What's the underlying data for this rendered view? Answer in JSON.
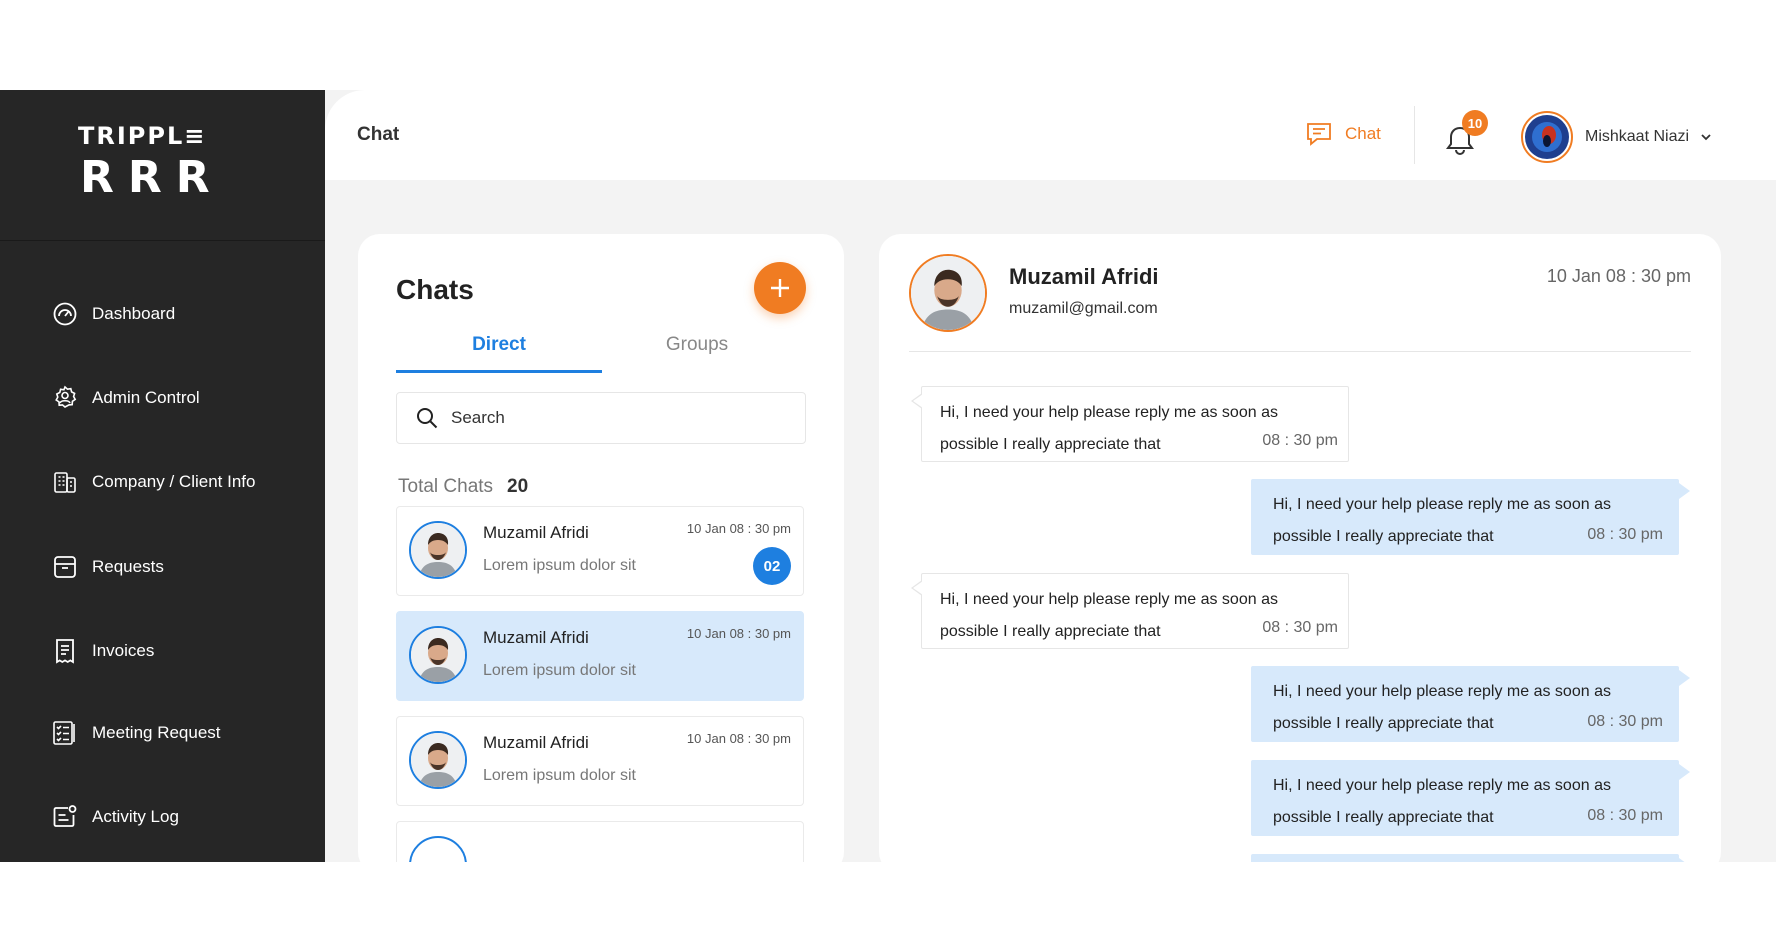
{
  "brand": {
    "line1": "TRIPPL≡",
    "line2": "RRR"
  },
  "sidebar": {
    "items": [
      {
        "label": "Dashboard",
        "icon": "dashboard-gauge-icon"
      },
      {
        "label": "Admin Control",
        "icon": "admin-gear-person-icon"
      },
      {
        "label": "Company / Client Info",
        "icon": "building-icon"
      },
      {
        "label": "Requests",
        "icon": "archive-box-icon"
      },
      {
        "label": "Invoices",
        "icon": "receipt-icon"
      },
      {
        "label": "Meeting Request",
        "icon": "checklist-icon"
      },
      {
        "label": "Activity Log",
        "icon": "activity-log-icon"
      }
    ]
  },
  "header": {
    "title": "Chat",
    "chat_link": "Chat",
    "notification_count": "10",
    "user_name": "Mishkaat Niazi"
  },
  "chats": {
    "title": "Chats",
    "tabs": [
      "Direct",
      "Groups"
    ],
    "active_tab": "Direct",
    "search_placeholder": "Search",
    "total_label": "Total Chats",
    "total_count": "20",
    "items": [
      {
        "name": "Muzamil Afridi",
        "message": "Lorem ipsum dolor sit",
        "time": "10 Jan 08 : 30 pm",
        "unread": "02",
        "active": false
      },
      {
        "name": "Muzamil Afridi",
        "message": "Lorem ipsum dolor sit",
        "time": "10 Jan 08 : 30 pm",
        "unread": "",
        "active": true
      },
      {
        "name": "Muzamil Afridi",
        "message": "Lorem ipsum dolor sit",
        "time": "10 Jan 08 : 30 pm",
        "unread": "",
        "active": false
      }
    ]
  },
  "conversation": {
    "name": "Muzamil Afridi",
    "email": "muzamil@gmail.com",
    "time": "10 Jan 08 : 30 pm",
    "messages": [
      {
        "direction": "in",
        "line1": "Hi, I need your help please reply me as soon as",
        "line2": "possible I really appreciate that",
        "time": "08 : 30 pm"
      },
      {
        "direction": "out",
        "line1": "Hi, I need your help please reply me as soon as",
        "line2": "possible I really appreciate that",
        "time": "08 : 30 pm"
      },
      {
        "direction": "in",
        "line1": "Hi, I need your help please reply me as soon as",
        "line2": "possible I really appreciate that",
        "time": "08 : 30 pm"
      },
      {
        "direction": "out",
        "line1": "Hi, I need your help please reply me as soon as",
        "line2": "possible I really appreciate that",
        "time": "08 : 30 pm"
      },
      {
        "direction": "out",
        "line1": "Hi, I need your help please reply me as soon as",
        "line2": "possible I really appreciate that",
        "time": "08 : 30 pm"
      }
    ]
  },
  "colors": {
    "accent": "#f07c22",
    "primary": "#1e7fe0",
    "sidebar": "#262626",
    "bubble_out": "#d7e9fb"
  }
}
